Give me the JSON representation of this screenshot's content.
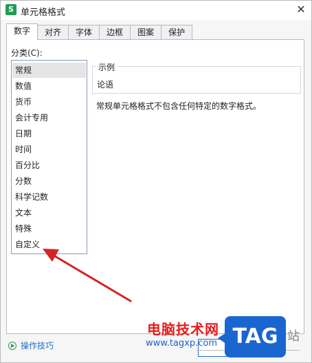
{
  "window": {
    "title": "单元格格式",
    "app_icon_letter": "S",
    "close_glyph": "✕"
  },
  "tabs": [
    {
      "label": "数字",
      "active": true
    },
    {
      "label": "对齐",
      "active": false
    },
    {
      "label": "字体",
      "active": false
    },
    {
      "label": "边框",
      "active": false
    },
    {
      "label": "图案",
      "active": false
    },
    {
      "label": "保护",
      "active": false
    }
  ],
  "category": {
    "label": "分类(C):",
    "items": [
      "常规",
      "数值",
      "货币",
      "会计专用",
      "日期",
      "时间",
      "百分比",
      "分数",
      "科学记数",
      "文本",
      "特殊",
      "自定义"
    ],
    "selected_index": 0
  },
  "sample": {
    "legend": "示例",
    "value": "论语"
  },
  "description": "常规单元格格式不包含任何特定的数字格式。",
  "footer": {
    "tips_label": "操作技巧"
  },
  "watermark": {
    "site_cn": "电脑技术网",
    "site_url": "www.tagxp.com",
    "tag_text": "TAG",
    "zhan": "站"
  },
  "colors": {
    "accent": "#1f6fcf",
    "arrow": "#d42323",
    "app_icon": "#1f9d55"
  }
}
